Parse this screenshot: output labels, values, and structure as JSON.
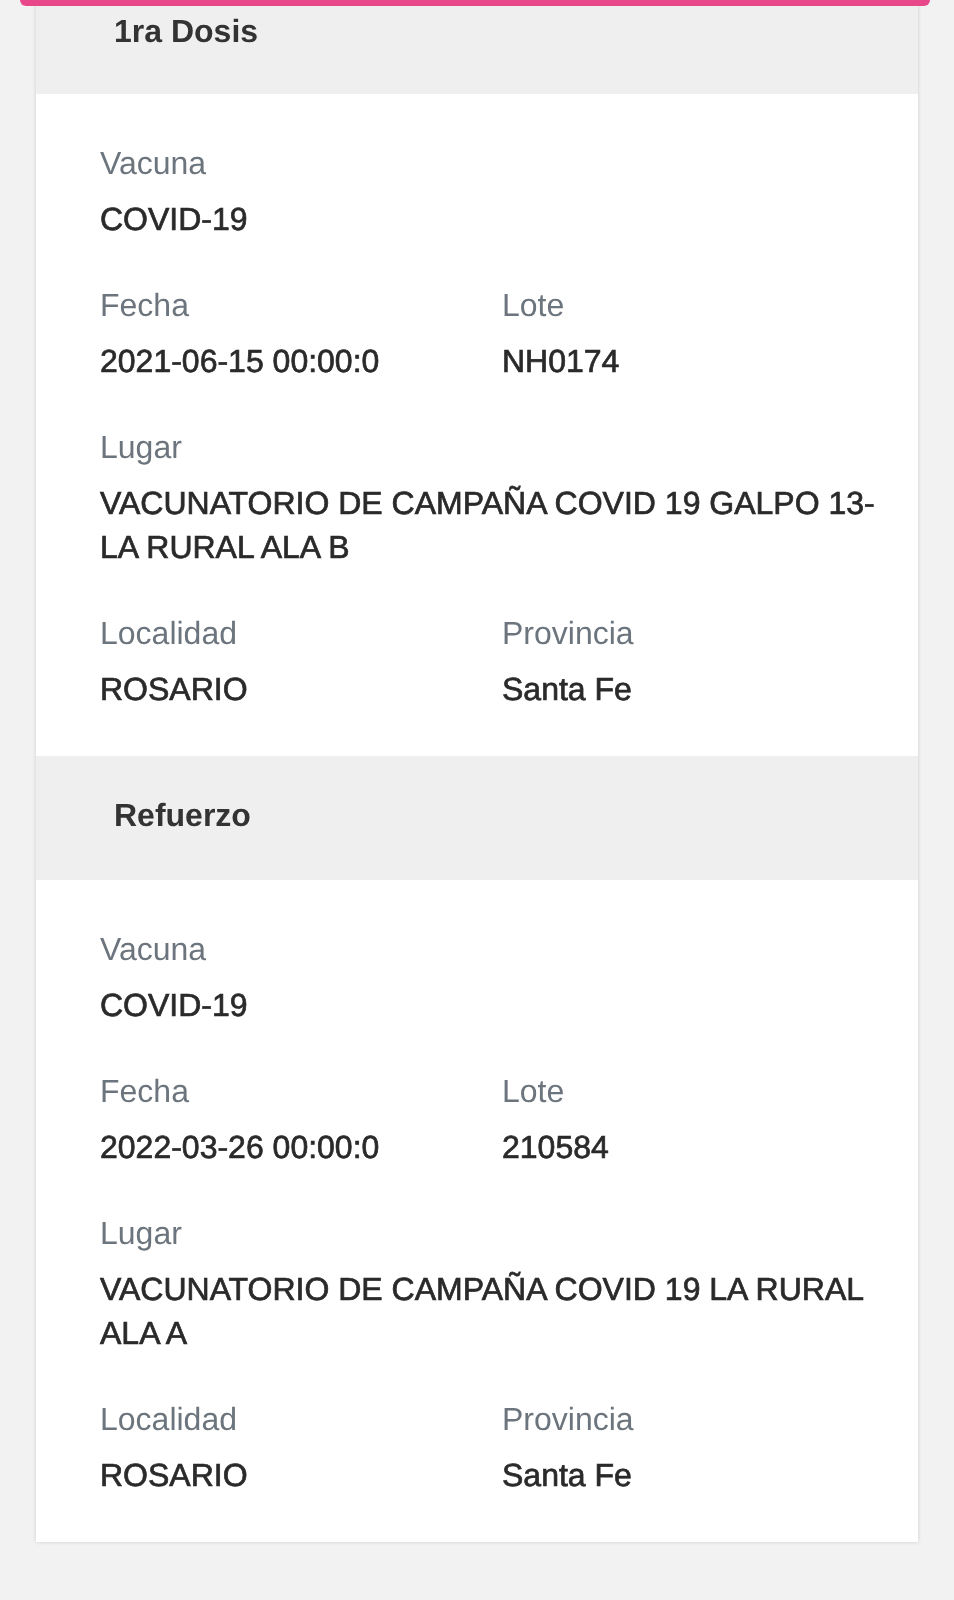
{
  "doses": [
    {
      "title": "1ra Dosis",
      "rows": [
        [
          {
            "label": "Vacuna",
            "value": "COVID-19"
          }
        ],
        [
          {
            "label": "Fecha",
            "value": "2021-06-15 00:00:0"
          },
          {
            "label": "Lote",
            "value": "NH0174"
          }
        ],
        [
          {
            "label": "Lugar",
            "value": "VACUNATORIO DE CAMPAÑA COVID 19 GALPO 13- LA RURAL ALA B"
          }
        ],
        [
          {
            "label": "Localidad",
            "value": "ROSARIO"
          },
          {
            "label": "Provincia",
            "value": "Santa Fe"
          }
        ]
      ]
    },
    {
      "title": "Refuerzo",
      "rows": [
        [
          {
            "label": "Vacuna",
            "value": "COVID-19"
          }
        ],
        [
          {
            "label": "Fecha",
            "value": "2022-03-26 00:00:0"
          },
          {
            "label": "Lote",
            "value": "210584"
          }
        ],
        [
          {
            "label": "Lugar",
            "value": "VACUNATORIO DE CAMPAÑA COVID 19 LA RURAL ALA A"
          }
        ],
        [
          {
            "label": "Localidad",
            "value": "ROSARIO"
          },
          {
            "label": "Provincia",
            "value": "Santa Fe"
          }
        ]
      ]
    }
  ]
}
